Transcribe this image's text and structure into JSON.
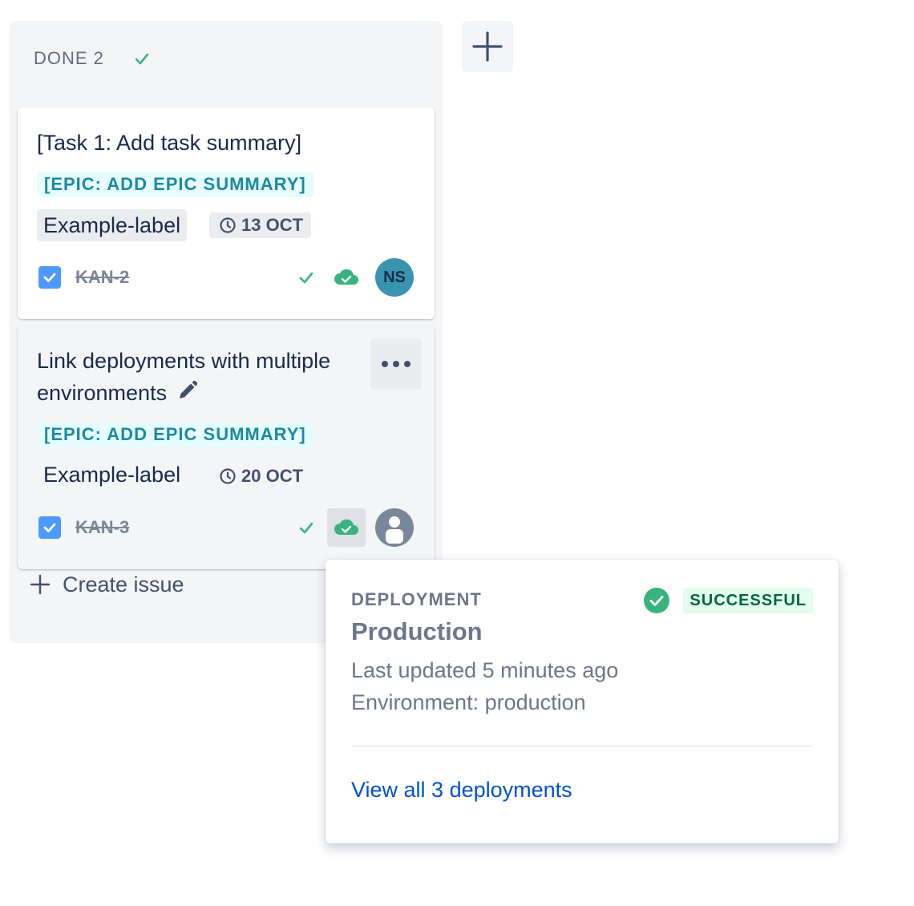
{
  "column": {
    "title": "DONE 2",
    "add_column_icon": "plus-icon"
  },
  "cards": [
    {
      "title": "[Task 1: Add task summary]",
      "epic": "[EPIC: ADD EPIC SUMMARY]",
      "label": "Example-label",
      "due_date": "13 OCT",
      "issue_key": "KAN-2",
      "assignee_initials": "NS"
    },
    {
      "title": "Link deployments with multiple environments",
      "epic": "[EPIC: ADD EPIC SUMMARY]",
      "label": "Example-label",
      "due_date": "20 OCT",
      "issue_key": "KAN-3",
      "assignee": "unassigned-avatar-icon"
    }
  ],
  "create_issue": {
    "label": "Create issue"
  },
  "deployment_popup": {
    "heading": "DEPLOYMENT",
    "status": "SUCCESSFUL",
    "environment_title": "Production",
    "last_updated": "Last updated 5 minutes ago",
    "environment": "Environment: production",
    "view_all_link": "View all 3 deployments"
  },
  "colors": {
    "column_bg": "#f4f5f7",
    "epic_text": "#1c8aa0",
    "epic_bg": "#e6fcff",
    "success_green": "#36b37e",
    "link_blue": "#0052cc",
    "checkbox_blue": "#4c9aff",
    "avatar_ns": "#3994b0"
  }
}
